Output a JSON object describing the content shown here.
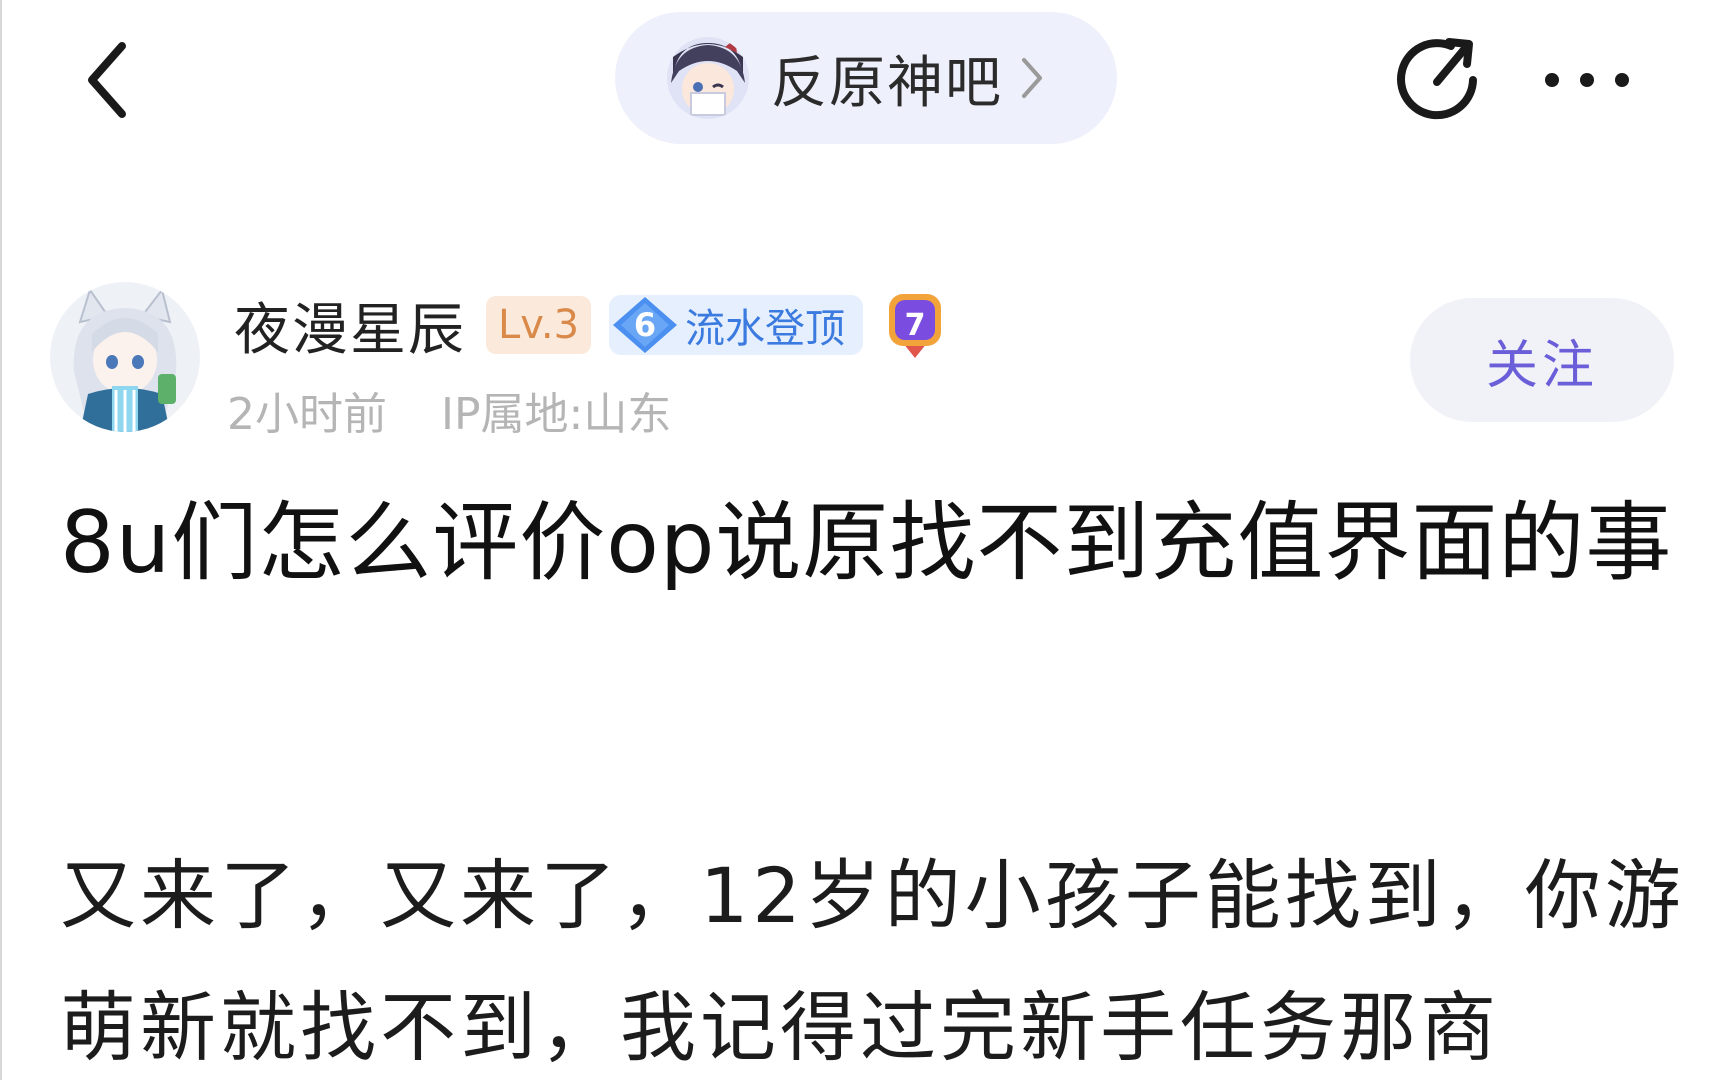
{
  "header": {
    "forum_name": "反原神吧"
  },
  "author": {
    "name": "夜漫星辰",
    "level": "Lv.3",
    "honor_level": "6",
    "honor_title": "流水登顶",
    "medal_number": "7",
    "posted_time": "2小时前",
    "ip_location": "IP属地:山东",
    "follow_label": "关注"
  },
  "post": {
    "title": "8u们怎么评价op说原找不到充值界面的事",
    "body": "又来了，又来了，12岁的小孩子能找到，你游萌新就找不到，我记得过完新手任务那商"
  },
  "icons": {
    "back": "chevron-left-icon",
    "forum_chevron": "chevron-right-icon",
    "share": "share-icon",
    "more": "more-dots-icon"
  },
  "colors": {
    "pill_bg": "#eef0fb",
    "follow_text": "#6a5fd8",
    "honor_text": "#3b7be0",
    "level_text": "#d98a4a",
    "meta_text": "#b5b5b5"
  }
}
